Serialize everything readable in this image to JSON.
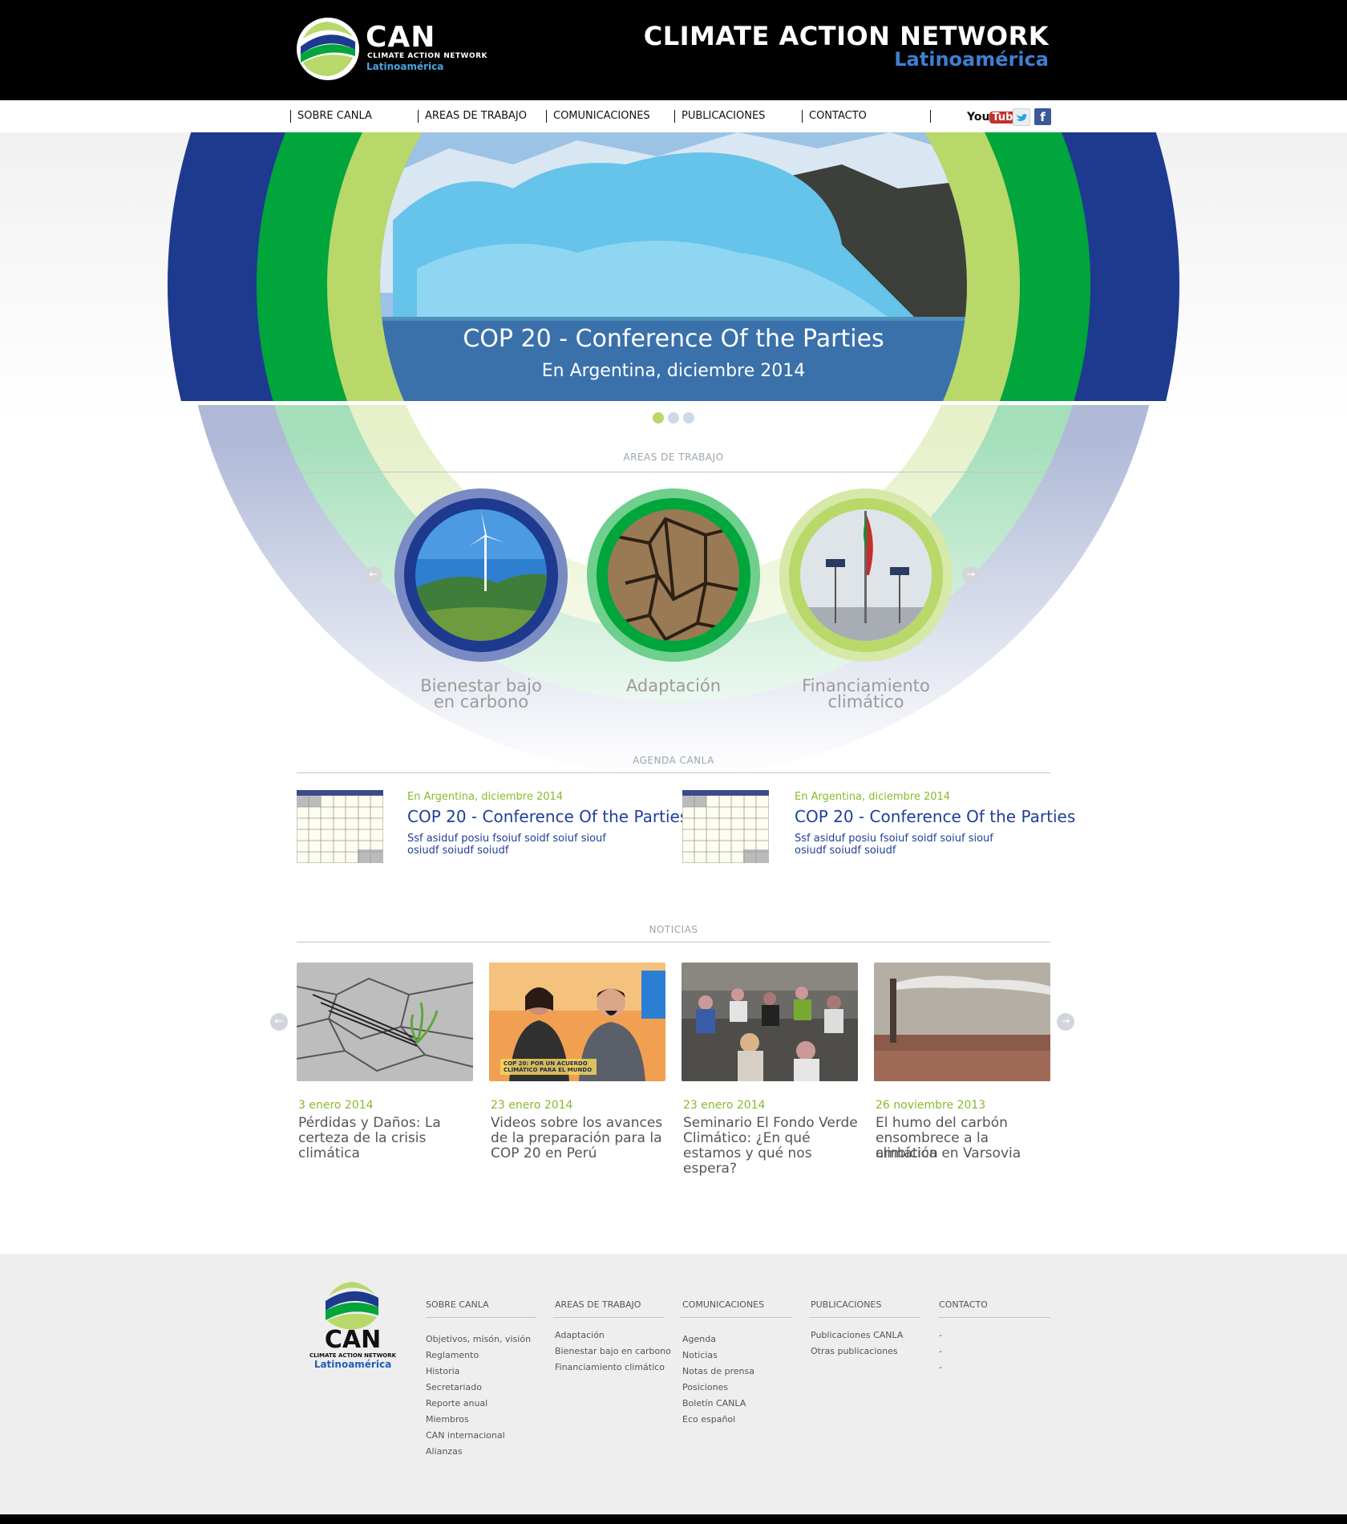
{
  "header": {
    "logo_title": "CAN",
    "logo_subtitle": "CLIMATE ACTION NETWORK",
    "logo_region": "Latinoamérica",
    "site_title": "CLIMATE ACTION NETWORK",
    "site_subtitle": "Latinoamérica"
  },
  "nav": {
    "items": [
      {
        "label": "SOBRE CANLA"
      },
      {
        "label": "AREAS DE TRABAJO"
      },
      {
        "label": "COMUNICACIONES"
      },
      {
        "label": "PUBLICACIONES"
      },
      {
        "label": "CONTACTO"
      }
    ],
    "social": {
      "youtube_you": "You",
      "youtube_tube": "Tube",
      "twitter": "twitter-icon",
      "facebook": "facebook-icon"
    }
  },
  "hero": {
    "title": "COP 20 - Conference Of the Parties",
    "subtitle": "En Argentina, diciembre 2014",
    "slides_total": 3,
    "active_slide": 1
  },
  "areas": {
    "section_title": "AREAS DE TRABAJO",
    "items": [
      {
        "label_line1": "Bienestar bajo",
        "label_line2": "en carbono",
        "icon": "wind-turbine-image"
      },
      {
        "label_line1": "Adaptación",
        "label_line2": "",
        "icon": "cracked-earth-image"
      },
      {
        "label_line1": "Financiamiento",
        "label_line2": "climático",
        "icon": "solar-flag-image"
      }
    ]
  },
  "agenda": {
    "section_title": "AGENDA CANLA",
    "items": [
      {
        "date": "En Argentina, diciembre 2014",
        "title": "COP 20 - Conference Of the Parties",
        "desc_line1": "Ssf asiduf posiu fsoiuf soidf soiuf siouf",
        "desc_line2": "osiudf soiudf soiudf"
      },
      {
        "date": "En Argentina, diciembre 2014",
        "title": "COP 20 - Conference Of the Parties",
        "desc_line1": "Ssf asiduf posiu fsoiuf soidf soiuf siouf",
        "desc_line2": "osiudf soiudf soiudf"
      }
    ]
  },
  "news": {
    "section_title": "NOTICIAS",
    "items": [
      {
        "date": "3 enero 2014",
        "title_l1": "Pérdidas y Daños: La",
        "title_l2": "certeza de la crisis",
        "title_l3": "climática"
      },
      {
        "date": "23 enero 2014",
        "title_l1": "Videos sobre los avances",
        "title_l2": "de la preparación para la",
        "title_l3": "COP 20 en Perú",
        "caption_l1": "COP 20: POR UN ACUERDO",
        "caption_l2": "CLIMÁTICO PARA EL MUNDO"
      },
      {
        "date": "23 enero 2014",
        "title_l1": "Seminario El Fondo Verde",
        "title_l2": "Climático: ¿En qué",
        "title_l3": "estamos y qué nos espera?"
      },
      {
        "date": "26 noviembre 2013",
        "title_l1": "El humo del carbón",
        "title_l2": "ensombrece a la ambición",
        "title_l3": "climática en Varsovia"
      }
    ]
  },
  "footer": {
    "logo_title": "CAN",
    "logo_subtitle": "CLIMATE ACTION NETWORK",
    "logo_region": "Latinoamérica",
    "columns": [
      {
        "heading": "SOBRE CANLA",
        "links": [
          "Objetivos, misón, visión",
          "Reglamento",
          "Historia",
          "Secretariado",
          "Reporte anual",
          "Miembros",
          "CAN internacional",
          "Alianzas"
        ]
      },
      {
        "heading": "AREAS DE TRABAJO",
        "links": [
          "Adaptación",
          "Bienestar bajo en carbono",
          "Financiamiento climático"
        ]
      },
      {
        "heading": "COMUNICACIONES",
        "links": [
          "Agenda",
          "Noticias",
          "Notas de prensa",
          "Posiciones",
          "Boletín CANLA",
          "Eco español"
        ]
      },
      {
        "heading": "PUBLICACIONES",
        "links": [
          "Publicaciones CANLA",
          "Otras publicaciones"
        ]
      },
      {
        "heading": "CONTACTO",
        "links": [
          "-",
          "-",
          "-"
        ]
      }
    ]
  },
  "colors": {
    "navy": "#1e3a8f",
    "green": "#00a53c",
    "lime": "#b8d86a",
    "accent_date": "#8ab92d",
    "link_blue": "#1f3f99"
  }
}
